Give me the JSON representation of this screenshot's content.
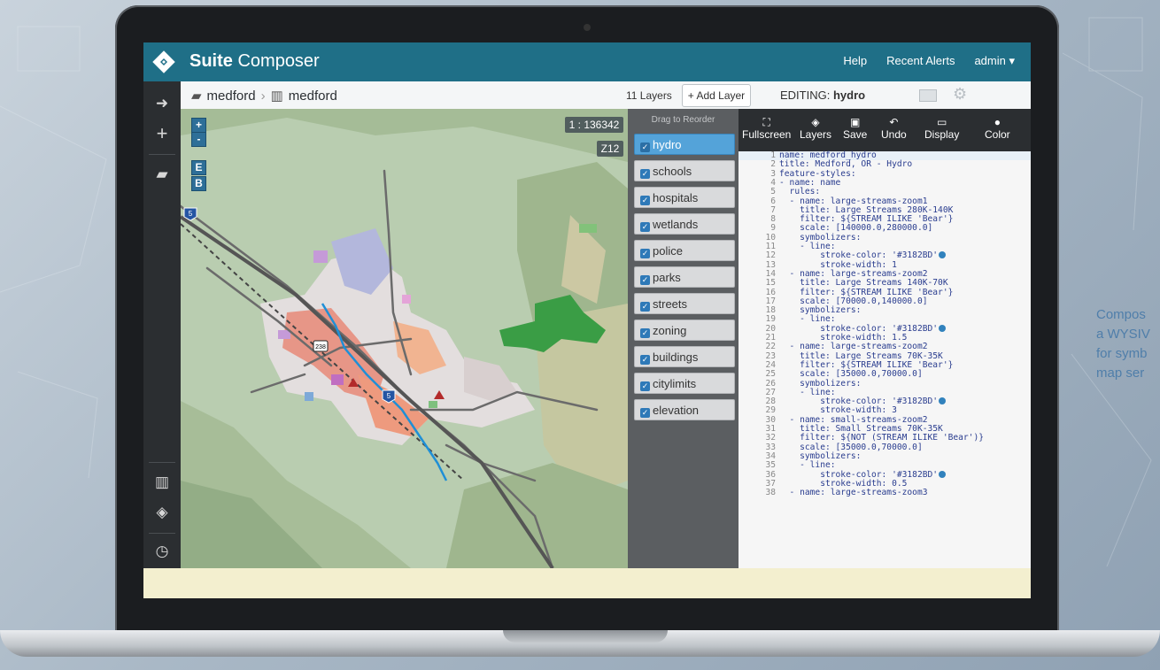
{
  "app": {
    "brand_bold": "Suite",
    "brand_rest": " Composer"
  },
  "topnav": [
    "Help",
    "Recent Alerts",
    "admin ▾"
  ],
  "breadcrumb": {
    "workspace": "medford",
    "map": "medford"
  },
  "toolbar": {
    "layer_count": "11 Layers",
    "add_layer": "+ Add Layer",
    "editing_label": "EDITING:",
    "editing_layer": "hydro"
  },
  "map": {
    "scale": "1 : 136342",
    "zoom": "Z12",
    "zoom_in": "+",
    "zoom_out": "-",
    "btn_e": "E",
    "btn_b": "B",
    "shields": [
      "5",
      "238",
      "5"
    ]
  },
  "layer_panel": {
    "header": "Drag to Reorder",
    "layers": [
      "hydro",
      "schools",
      "hospitals",
      "wetlands",
      "police",
      "parks",
      "streets",
      "zoning",
      "buildings",
      "citylimits",
      "elevation"
    ],
    "active": "hydro"
  },
  "editor_tools": [
    "Fullscreen",
    "Layers",
    "Save",
    "Undo",
    "Display",
    "Color"
  ],
  "code_lines": [
    "name: medford_hydro",
    "title: Medford, OR - Hydro",
    "feature-styles:",
    "- name: name",
    "  rules:",
    "  - name: large-streams-zoom1",
    "    title: Large Streams 280K-140K",
    "    filter: ${STREAM ILIKE 'Bear'}",
    "    scale: [140000.0,280000.0]",
    "    symbolizers:",
    "    - line:",
    "        stroke-color: '#3182BD'",
    "        stroke-width: 1",
    "  - name: large-streams-zoom2",
    "    title: Large Streams 140K-70K",
    "    filter: ${STREAM ILIKE 'Bear'}",
    "    scale: [70000.0,140000.0]",
    "    symbolizers:",
    "    - line:",
    "        stroke-color: '#3182BD'",
    "        stroke-width: 1.5",
    "  - name: large-streams-zoom2",
    "    title: Large Streams 70K-35K",
    "    filter: ${STREAM ILIKE 'Bear'}",
    "    scale: [35000.0,70000.0]",
    "    symbolizers:",
    "    - line:",
    "        stroke-color: '#3182BD'",
    "        stroke-width: 3",
    "  - name: small-streams-zoom2",
    "    title: Small Streams 70K-35K",
    "    filter: ${NOT (STREAM ILIKE 'Bear')}",
    "    scale: [35000.0,70000.0]",
    "    symbolizers:",
    "    - line:",
    "        stroke-color: '#3182BD'",
    "        stroke-width: 0.5",
    "  - name: large-streams-zoom3"
  ],
  "side_caption": [
    "Compos",
    "a WYSIV",
    "for symb",
    "map ser"
  ],
  "colors": {
    "topbar": "#1f6f87",
    "rail": "#2b2e31",
    "accent": "#54a3d9",
    "stroke": "#3182BD"
  }
}
